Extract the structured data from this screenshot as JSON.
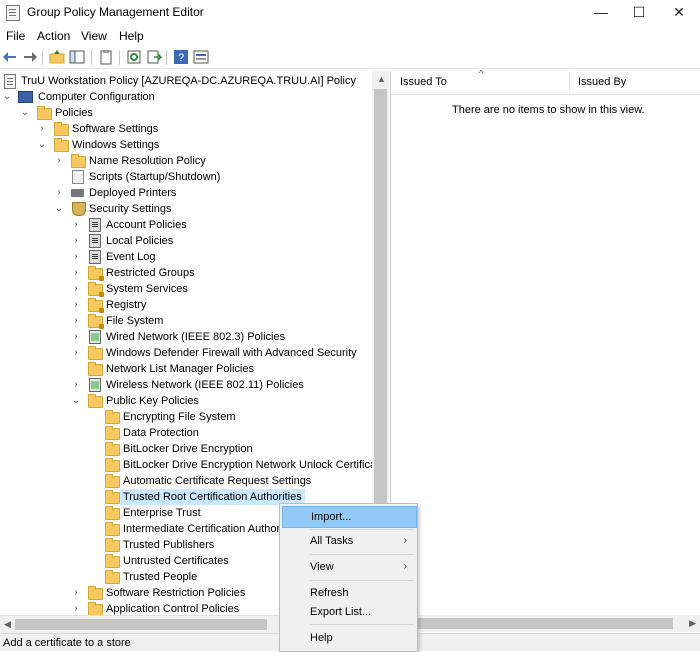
{
  "window": {
    "title": "Group Policy Management Editor",
    "minimize": "—",
    "maximize": "☐",
    "close": "✕"
  },
  "menu": [
    "File",
    "Action",
    "View",
    "Help"
  ],
  "tree": {
    "root": "TruU Workstation Policy [AZUREQA-DC.AZUREQA.TRUU.AI] Policy",
    "computer_configuration": "Computer Configuration",
    "policies": "Policies",
    "software_settings": "Software Settings",
    "windows_settings": "Windows Settings",
    "name_resolution": "Name Resolution Policy",
    "scripts": "Scripts (Startup/Shutdown)",
    "deployed_printers": "Deployed Printers",
    "security_settings": "Security Settings",
    "account_policies": "Account Policies",
    "local_policies": "Local Policies",
    "event_log": "Event Log",
    "restricted_groups": "Restricted Groups",
    "system_services": "System Services",
    "registry": "Registry",
    "file_system": "File System",
    "wired_network": "Wired Network (IEEE 802.3) Policies",
    "firewall": "Windows Defender Firewall with Advanced Security",
    "network_list": "Network List Manager Policies",
    "wireless_network": "Wireless Network (IEEE 802.11) Policies",
    "public_key": "Public Key Policies",
    "efs": "Encrypting File System",
    "data_protection": "Data Protection",
    "bitlocker": "BitLocker Drive Encryption",
    "bitlocker_unlock": "BitLocker Drive Encryption Network Unlock Certificat",
    "auto_cert": "Automatic Certificate Request Settings",
    "trusted_root": "Trusted Root Certification Authorities",
    "enterprise_trust": "Enterprise Trust",
    "intermediate_ca": "Intermediate Certification Author",
    "trusted_publishers": "Trusted Publishers",
    "untrusted_certs": "Untrusted Certificates",
    "trusted_people": "Trusted People",
    "software_restriction": "Software Restriction Policies",
    "app_control": "Application Control Policies"
  },
  "list": {
    "col_issued_to": "Issued To",
    "col_issued_by": "Issued By",
    "empty": "There are no items to show in this view."
  },
  "context_menu": {
    "import": "Import...",
    "all_tasks": "All Tasks",
    "view": "View",
    "refresh": "Refresh",
    "export_list": "Export List...",
    "help": "Help"
  },
  "status": "Add a certificate to a store"
}
